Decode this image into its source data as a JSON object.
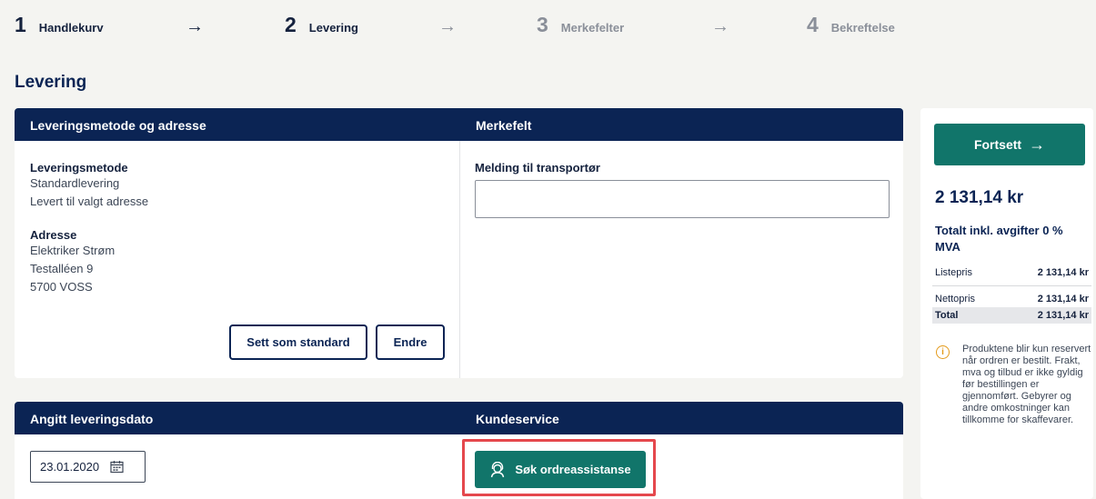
{
  "stepper": [
    {
      "num": "1",
      "label": "Handlekurv"
    },
    {
      "num": "2",
      "label": "Levering"
    },
    {
      "num": "3",
      "label": "Merkefelter"
    },
    {
      "num": "4",
      "label": "Bekreftelse"
    }
  ],
  "arrow": "→",
  "page_title": "Levering",
  "delivery_card": {
    "left_header": "Leveringsmetode og adresse",
    "right_header": "Merkefelt",
    "method_label": "Leveringsmetode",
    "method_lines": [
      "Standardlevering",
      "Levert til valgt adresse"
    ],
    "address_label": "Adresse",
    "address_lines": [
      "Elektriker Strøm",
      "Testalléen 9",
      "5700 VOSS"
    ],
    "set_default_button": "Sett som standard",
    "edit_button": "Endre",
    "carrier_message_label": "Melding til transportør",
    "carrier_message_value": ""
  },
  "date_card": {
    "left_header": "Angitt leveringsdato",
    "right_header": "Kundeservice",
    "date_value": "23.01.2020",
    "order_assist_button": "Søk ordreassistanse"
  },
  "sidebar": {
    "continue_button": "Fortsett",
    "total_amount": "2 131,14 kr",
    "total_caption": "Totalt inkl. avgifter 0 % MVA",
    "list_price_label": "Listepris",
    "list_price_value": "2 131,14 kr",
    "net_price_label": "Nettopris",
    "net_price_value": "2 131,14 kr",
    "total_label": "Total",
    "total_value": "2 131,14 kr",
    "info_text": "Produktene blir kun reservert når ordren er bestilt. Frakt, mva og tilbud er ikke gyldig før bestillingen er gjennomført. Gebyrer og andre omkostninger kan tillkomme for skaffevarer."
  },
  "colors": {
    "navy": "#0b2454",
    "green": "#11756a",
    "highlight": "#e5484d",
    "info": "#e39a1a",
    "background": "#f4f4f1"
  },
  "icons": {
    "arrow": "arrow-right-icon",
    "calendar": "calendar-icon",
    "assistant": "support-agent-icon",
    "info": "info-icon"
  }
}
